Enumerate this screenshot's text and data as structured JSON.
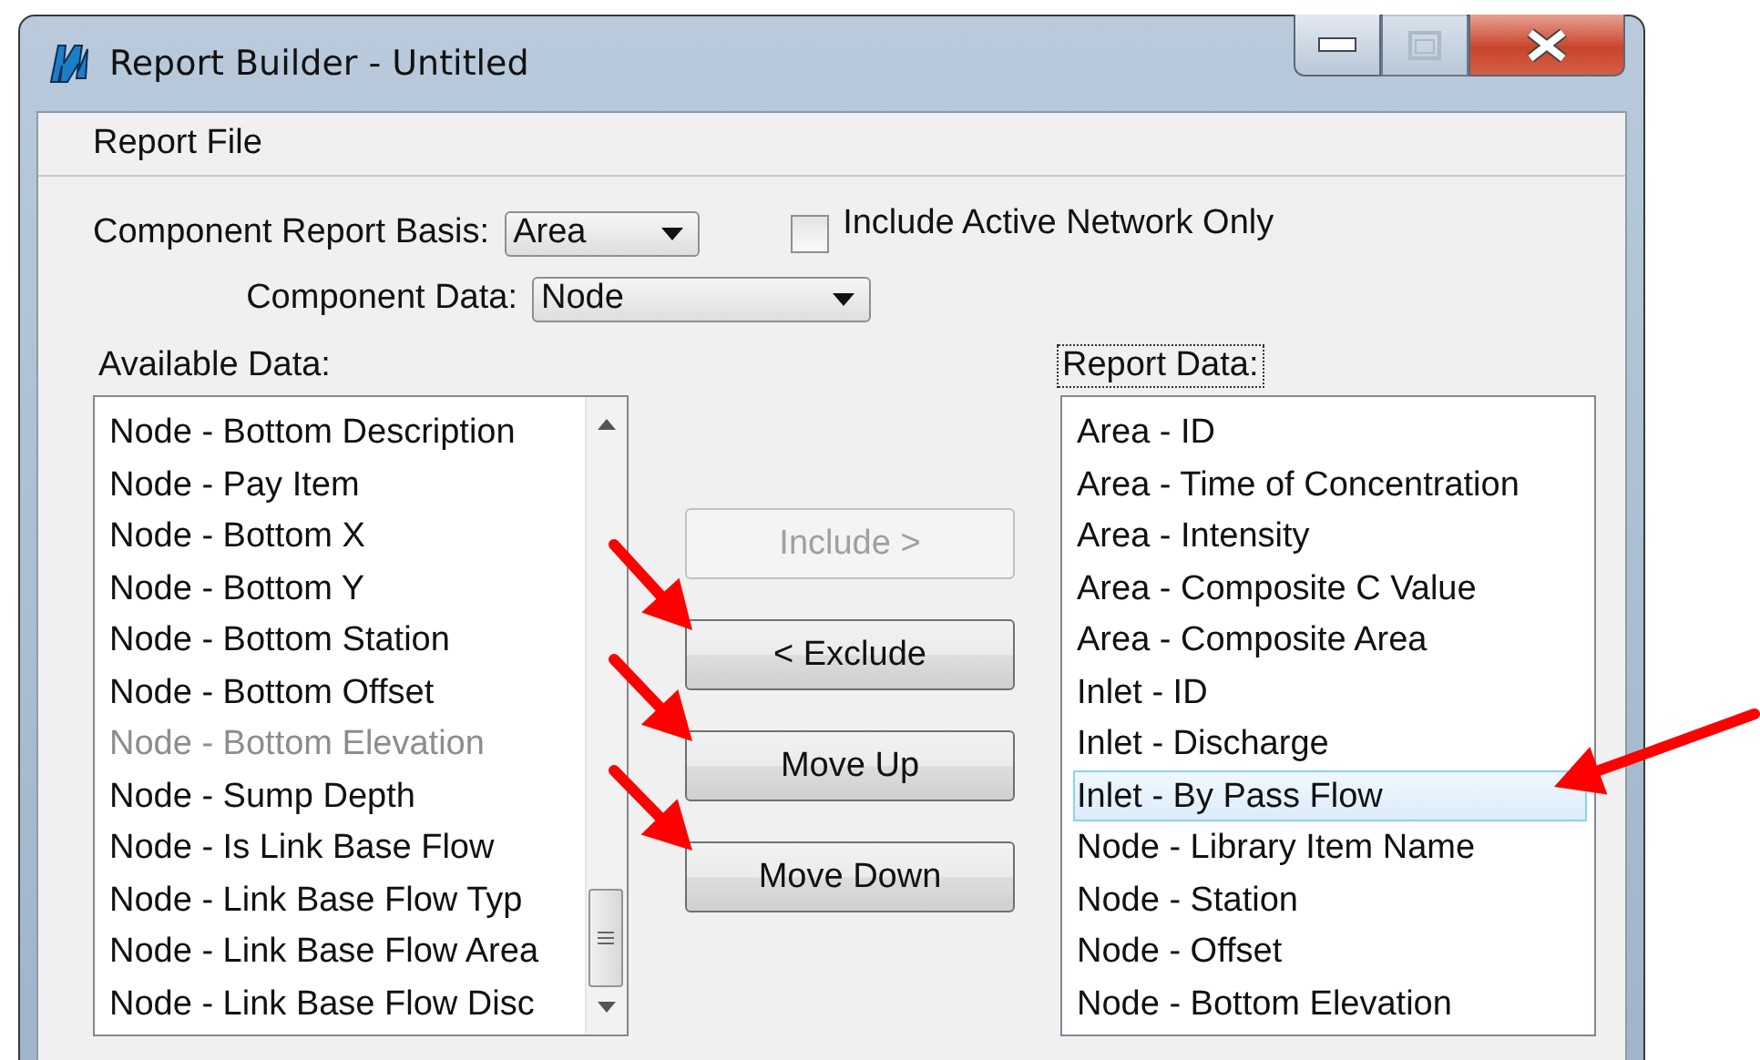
{
  "window": {
    "title": "Report Builder - Untitled",
    "controls": [
      {
        "kind": "minimize",
        "disabled": false
      },
      {
        "kind": "maximize",
        "disabled": true
      },
      {
        "kind": "close",
        "disabled": false
      }
    ]
  },
  "menu": [
    "Report File"
  ],
  "basis": {
    "label": "Component Report Basis:",
    "value": "Area"
  },
  "include_active": {
    "label": "Include Active Network Only",
    "checked": false
  },
  "component_data": {
    "label": "Component Data:",
    "value": "Node"
  },
  "available": {
    "label": "Available Data:",
    "items": [
      {
        "text": "Node - Bottom Description",
        "disabled": false
      },
      {
        "text": "Node - Pay Item",
        "disabled": false
      },
      {
        "text": "Node - Bottom X",
        "disabled": false
      },
      {
        "text": "Node - Bottom Y",
        "disabled": false
      },
      {
        "text": "Node - Bottom Station",
        "disabled": false
      },
      {
        "text": "Node - Bottom Offset",
        "disabled": false
      },
      {
        "text": "Node - Bottom Elevation",
        "disabled": true
      },
      {
        "text": "Node - Sump Depth",
        "disabled": false
      },
      {
        "text": "Node - Is Link Base Flow",
        "disabled": false
      },
      {
        "text": "Node - Link Base Flow Typ",
        "disabled": false
      },
      {
        "text": "Node - Link Base Flow Area",
        "disabled": false
      },
      {
        "text": "Node - Link Base Flow Disc",
        "disabled": false
      }
    ]
  },
  "buttons": [
    {
      "label": "Include >",
      "disabled": true
    },
    {
      "label": "< Exclude",
      "disabled": false
    },
    {
      "label": "Move Up",
      "disabled": false
    },
    {
      "label": "Move Down",
      "disabled": false
    }
  ],
  "report": {
    "label": "Report Data:",
    "focused": true,
    "items": [
      {
        "text": "Area - ID",
        "selected": false
      },
      {
        "text": "Area - Time of Concentration",
        "selected": false
      },
      {
        "text": "Area - Intensity",
        "selected": false
      },
      {
        "text": "Area - Composite C Value",
        "selected": false
      },
      {
        "text": "Area - Composite Area",
        "selected": false
      },
      {
        "text": "Inlet - ID",
        "selected": false
      },
      {
        "text": "Inlet - Discharge",
        "selected": false
      },
      {
        "text": "Inlet - By Pass Flow",
        "selected": true
      },
      {
        "text": "Node - Library Item Name",
        "selected": false
      },
      {
        "text": "Node - Station",
        "selected": false
      },
      {
        "text": "Node - Offset",
        "selected": false
      },
      {
        "text": "Node - Bottom Elevation",
        "selected": false
      }
    ]
  }
}
